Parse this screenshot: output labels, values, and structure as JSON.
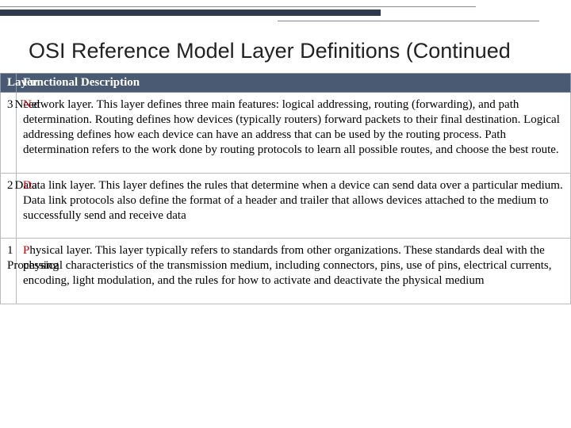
{
  "title": "OSI Reference Model Layer Definitions (Continued",
  "headers": {
    "layer": "Layer",
    "desc": "Functional Description"
  },
  "rows": [
    {
      "num": "3",
      "name": "Need",
      "prefix": "N",
      "desc": "etwork layer. This layer defines three main features: logical addressing, routing (forwarding), and path determination. Routing defines how devices (typically routers) forward packets to their final destination. Logical addressing defines how each device can have an address that can be used by the routing process. Path determination refers to the work done by routing protocols to learn all possible routes, and choose the best route."
    },
    {
      "num": "2",
      "name": "Data",
      "prefix": "D",
      "desc": "ata link layer. This layer defines the rules that determine when a device can send data over a particular medium. Data link protocols also define the format of a header and trailer that allows devices attached to the medium to successfully send and receive data"
    },
    {
      "num": "1",
      "name": "Processing",
      "prefix": "P",
      "desc": "hysical layer. This layer typically refers to standards from other organizations. These standards deal with the physical characteristics of the transmission medium, including connectors, pins, use of pins, electrical currents, encoding, light modulation, and the rules for how to activate and deactivate the physical medium"
    }
  ]
}
